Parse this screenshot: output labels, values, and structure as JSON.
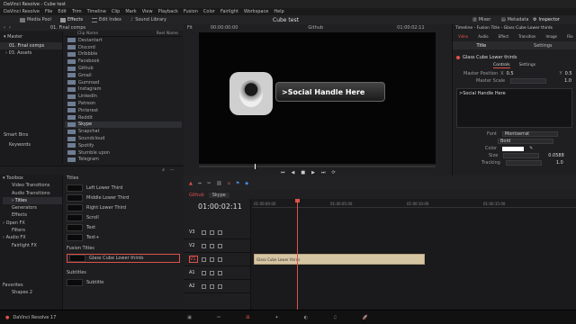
{
  "titlebar": {
    "app": "DaVinci Resolve - Cube test"
  },
  "menu": [
    "DaVinci Resolve",
    "File",
    "Edit",
    "Trim",
    "Timeline",
    "Clip",
    "Mark",
    "View",
    "Playback",
    "Fusion",
    "Color",
    "Fairlight",
    "Workspace",
    "Help"
  ],
  "toolbar": {
    "media_pool": "Media Pool",
    "effects": "Effects",
    "edit_index": "Edit Index",
    "sound_library": "Sound Library",
    "project_title": "Cube test",
    "mixer": "Mixer",
    "metadata": "Metadata",
    "inspector": "Inspector"
  },
  "media": {
    "bin_path": "01. Final comps",
    "master": "Master",
    "bins": [
      "01. Final comps",
      "03. Assets"
    ],
    "smart_bins": "Smart Bins",
    "keywords": "Keywords",
    "col_name": "Clip Name",
    "col_reel": "Reel Name",
    "clips": [
      "Deviantart",
      "Discord",
      "Dribbble",
      "Facebook",
      "Github",
      "Gmail",
      "Gumroad",
      "Instagram",
      "LinkedIn",
      "Patreon",
      "Pinterest",
      "Reddit",
      "Skype",
      "Snapchat",
      "Soundcloud",
      "Spotify",
      "Stumble upon",
      "Telegram"
    ],
    "selected_clip": "Skype"
  },
  "viewer": {
    "fit": "Fit",
    "timecode_left": "00:00:00:00",
    "clip_name": "Github",
    "timecode_right": "01:00:02:11",
    "lower_third_text": ">Social Handle Here"
  },
  "inspector": {
    "header": "Timeline - Fusion Title - Glass Cube Lower thirds",
    "tabs": [
      "Video",
      "Audio",
      "Effect",
      "Transition",
      "Image",
      "File"
    ],
    "subtabs": [
      "Title",
      "Settings"
    ],
    "effect_name": "Glass Cube Lower thirds",
    "ctrl_tabs": [
      "Controls",
      "Settings"
    ],
    "master_position_label": "Master Position",
    "pos_x_label": "X",
    "pos_x": "0.5",
    "pos_y_label": "Y",
    "pos_y": "0.5",
    "master_scale_label": "Master Scale",
    "master_scale": "1.0",
    "text_value": ">Social Handle Here",
    "font_label": "Font",
    "font_value": "Montserrat",
    "style_value": "Bold",
    "color_label": "Color",
    "size_label": "Size",
    "size_value": "0.0588",
    "tracking_label": "Tracking",
    "tracking_value": "1.0"
  },
  "effects": {
    "toolbox": "Toolbox",
    "video_transitions": "Video Transitions",
    "audio_transitions": "Audio Transitions",
    "titles": "Titles",
    "generators": "Generators",
    "effects": "Effects",
    "openfx": "Open FX",
    "filters": "Filters",
    "audiofx": "Audio FX",
    "fairlight_fx": "Fairlight FX",
    "favorites": "Favorites",
    "fav_item": "Shapes 2",
    "titles_header": "Titles",
    "title_items": [
      "Left Lower Third",
      "Middle Lower Third",
      "Right Lower Third",
      "Scroll",
      "Text",
      "Text+"
    ],
    "fusion_titles": "Fusion Titles",
    "fusion_item": "Glass Cube Lower thirds",
    "subtitles": "Subtitles",
    "subtitle_item": "Subtitle"
  },
  "timeline": {
    "timeline_name": "Github",
    "clip_dropdown": "Skype",
    "timecode": "01:00:02:11",
    "ruler": [
      "01:00:00:00",
      "01:00:05:00",
      "01:00:10:00",
      "01:00:15:00"
    ],
    "tracks": [
      "V3",
      "V2",
      "V1",
      "A1",
      "A2"
    ],
    "clip_label": "Glass Cube Lower thirds"
  },
  "bottom": {
    "app_version": "DaVinci Resolve 17"
  },
  "colors": {
    "accent": "#e0524a",
    "clip": "#d6c5a2",
    "lower_third_bg": "#2a2a2a"
  }
}
